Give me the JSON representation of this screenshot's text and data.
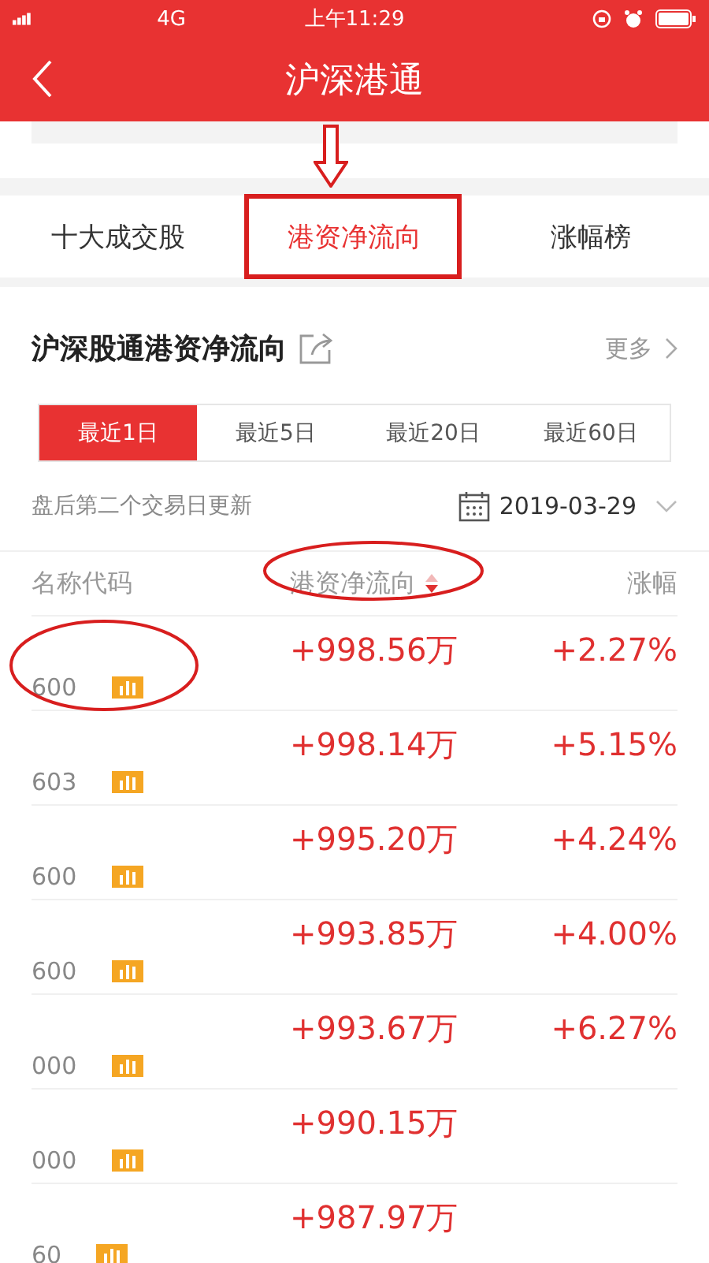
{
  "status_bar": {
    "network": "4G",
    "time": "上午11:29"
  },
  "nav": {
    "title": "沪深港通"
  },
  "tabs": [
    {
      "label": "十大成交股",
      "selected": false
    },
    {
      "label": "港资净流向",
      "selected": true
    },
    {
      "label": "涨幅榜",
      "selected": false
    }
  ],
  "section": {
    "title": "沪深股通港资净流向",
    "more": "更多"
  },
  "periods": [
    {
      "label": "最近1日",
      "selected": true
    },
    {
      "label": "最近5日",
      "selected": false
    },
    {
      "label": "最近20日",
      "selected": false
    },
    {
      "label": "最近60日",
      "selected": false
    }
  ],
  "update_note": "盘后第二个交易日更新",
  "date": "2019-03-29",
  "table": {
    "columns": [
      "名称代码",
      "港资净流向",
      "涨幅"
    ],
    "rows": [
      {
        "code": "600",
        "flow": "+998.56万",
        "change": "+2.27%"
      },
      {
        "code": "603",
        "flow": "+998.14万",
        "change": "+5.15%"
      },
      {
        "code": "600",
        "flow": "+995.20万",
        "change": "+4.24%"
      },
      {
        "code": "600",
        "flow": "+993.85万",
        "change": "+4.00%"
      },
      {
        "code": "000",
        "flow": "+993.67万",
        "change": "+6.27%"
      },
      {
        "code": "000",
        "flow": "+990.15万"
      },
      {
        "code": "60",
        "flow": "+987.97万"
      }
    ]
  }
}
